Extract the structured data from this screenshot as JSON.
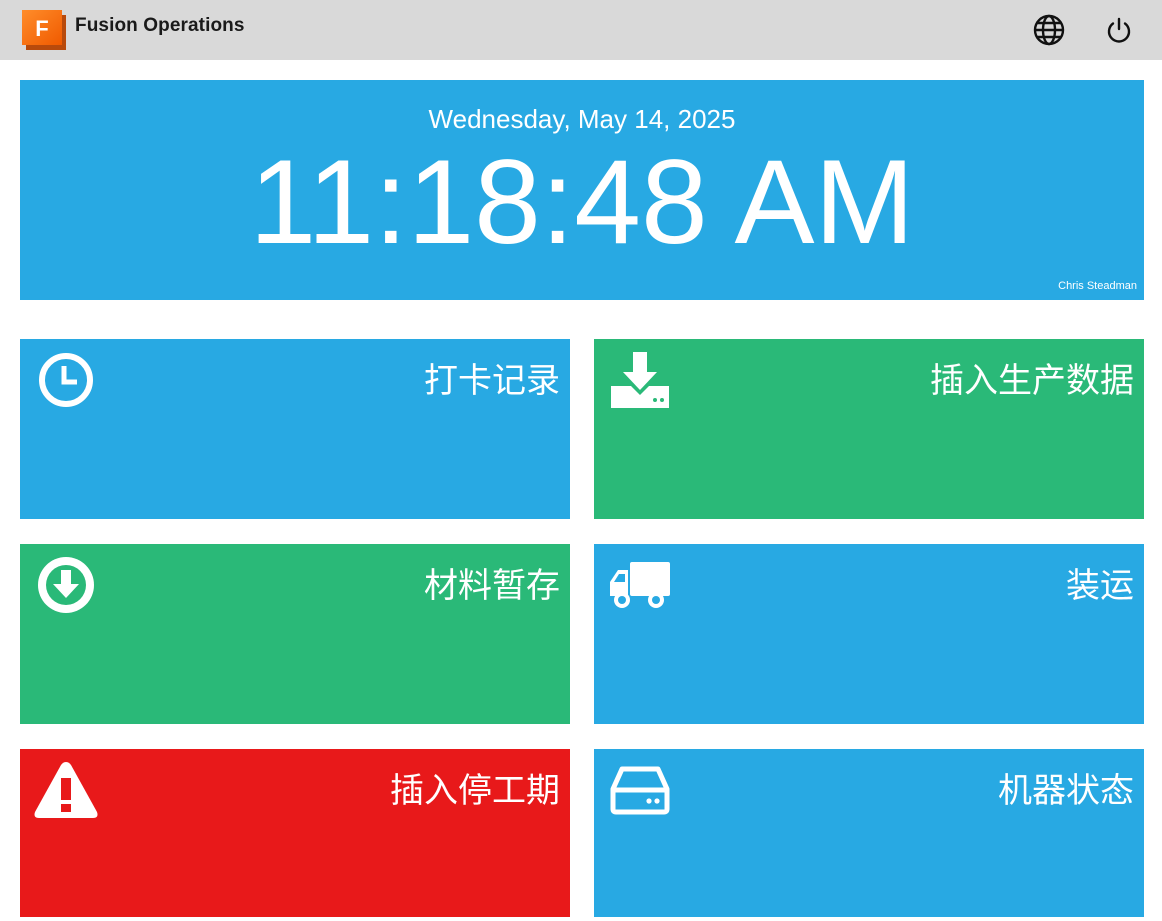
{
  "header": {
    "app_title": "Fusion Operations",
    "logo_letter": "F",
    "icons": [
      "globe-icon",
      "power-icon"
    ]
  },
  "clock": {
    "date": "Wednesday, May 14, 2025",
    "time": "11:18:48 AM",
    "user": "Chris Steadman"
  },
  "tiles": [
    {
      "label": "打卡记录",
      "icon": "clock-icon",
      "color": "#28a9e3"
    },
    {
      "label": "插入生产数据",
      "icon": "download-tray-icon",
      "color": "#2ab978"
    },
    {
      "label": "材料暂存",
      "icon": "arrow-down-circle-icon",
      "color": "#2ab978"
    },
    {
      "label": "装运",
      "icon": "truck-icon",
      "color": "#28a9e3"
    },
    {
      "label": "插入停工期",
      "icon": "warning-icon",
      "color": "#e8191a"
    },
    {
      "label": "机器状态",
      "icon": "hard-drive-icon",
      "color": "#28a9e3"
    }
  ],
  "colors": {
    "header_bg": "#d9d9d9",
    "blue": "#28a9e3",
    "green": "#2ab978",
    "red": "#e8191a",
    "logo_orange": "#ff6b00"
  }
}
